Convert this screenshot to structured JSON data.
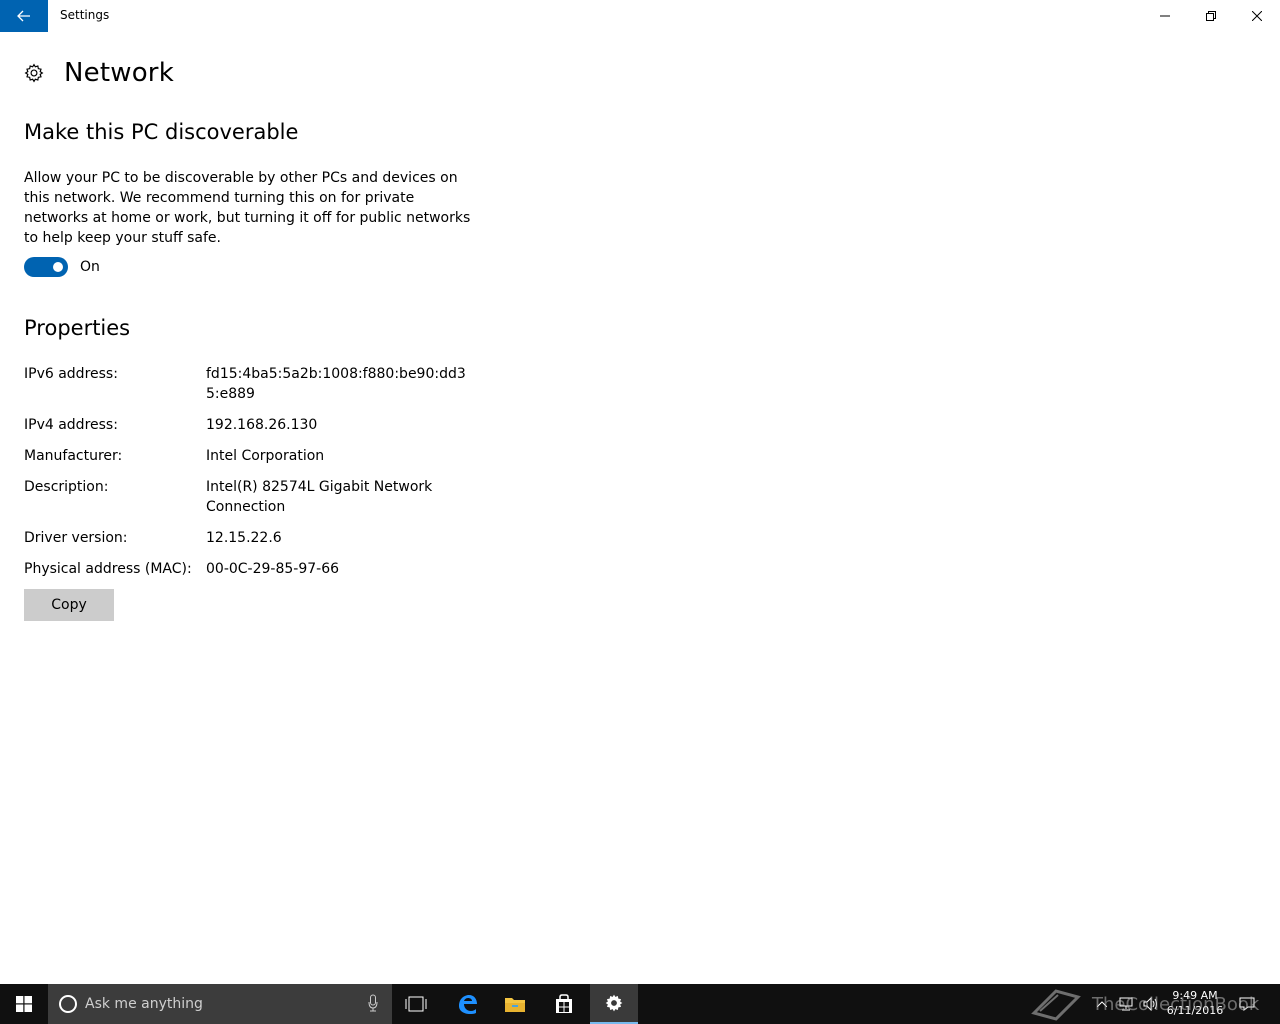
{
  "window": {
    "title": "Settings"
  },
  "header": {
    "title": "Network"
  },
  "discoverable": {
    "title": "Make this PC discoverable",
    "description": "Allow your PC to be discoverable by other PCs and devices on this network. We recommend turning this on for private networks at home or work, but turning it off for public networks to help keep your stuff safe.",
    "toggle_label": "On",
    "toggle_on": true
  },
  "properties": {
    "title": "Properties",
    "rows": [
      {
        "key": "IPv6 address:",
        "value": "fd15:4ba5:5a2b:1008:f880:be90:dd35:e889"
      },
      {
        "key": "IPv4 address:",
        "value": "192.168.26.130"
      },
      {
        "key": "Manufacturer:",
        "value": "Intel Corporation"
      },
      {
        "key": "Description:",
        "value": "Intel(R) 82574L Gigabit Network Connection"
      },
      {
        "key": "Driver version:",
        "value": "12.15.22.6"
      },
      {
        "key": "Physical address (MAC):",
        "value": "00-0C-29-85-97-66"
      }
    ],
    "copy_label": "Copy"
  },
  "taskbar": {
    "search_placeholder": "Ask me anything",
    "time": "9:49 AM",
    "date": "6/11/2016",
    "watermark": "TheCollectionBook"
  },
  "colors": {
    "accent": "#0063b1",
    "taskbar": "#101010",
    "button": "#cccccc"
  }
}
